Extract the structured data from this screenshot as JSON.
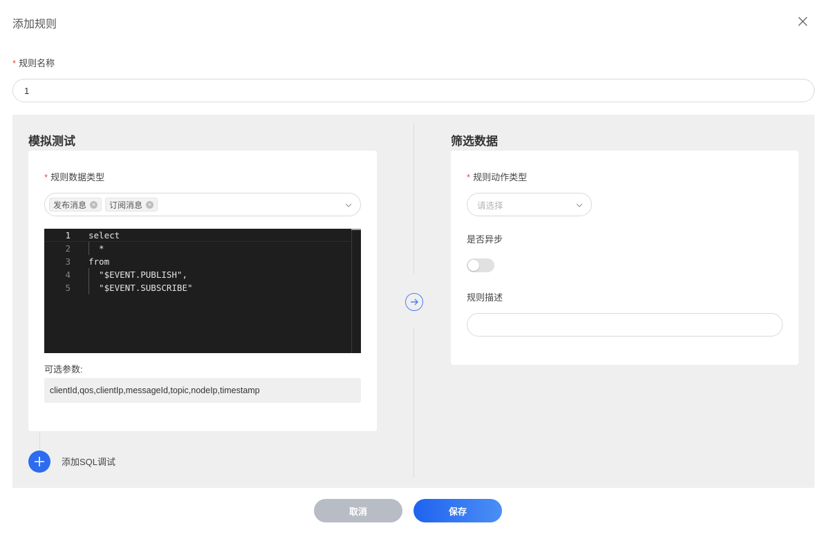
{
  "dialog": {
    "title": "添加规则"
  },
  "rule_name": {
    "label": "规则名称",
    "value": "1"
  },
  "simulate": {
    "title": "模拟测试",
    "data_type_label": "规则数据类型",
    "tags": [
      "发布消息",
      "订阅消息"
    ],
    "tag_remove_glyph": "×",
    "code_lines": [
      {
        "num": "1",
        "text": "select"
      },
      {
        "num": "2",
        "text": "  *"
      },
      {
        "num": "3",
        "text": "from"
      },
      {
        "num": "4",
        "text": "  \"$EVENT.PUBLISH\","
      },
      {
        "num": "5",
        "text": "  \"$EVENT.SUBSCRIBE\""
      }
    ],
    "params_label": "可选参数:",
    "params_value": "clientId,qos,clientIp,messageId,topic,nodeIp,timestamp",
    "add_sql_label": "添加SQL调试"
  },
  "filter": {
    "title": "筛选数据",
    "action_type_label": "规则动作类型",
    "action_type_placeholder": "请选择",
    "async_label": "是否异步",
    "async_enabled": false,
    "desc_label": "规则描述",
    "desc_value": ""
  },
  "footer": {
    "cancel_label": "取消",
    "save_label": "保存"
  },
  "colors": {
    "primary": "#2d6cf0",
    "required": "#e8473f",
    "panel_bg": "#efefef"
  }
}
